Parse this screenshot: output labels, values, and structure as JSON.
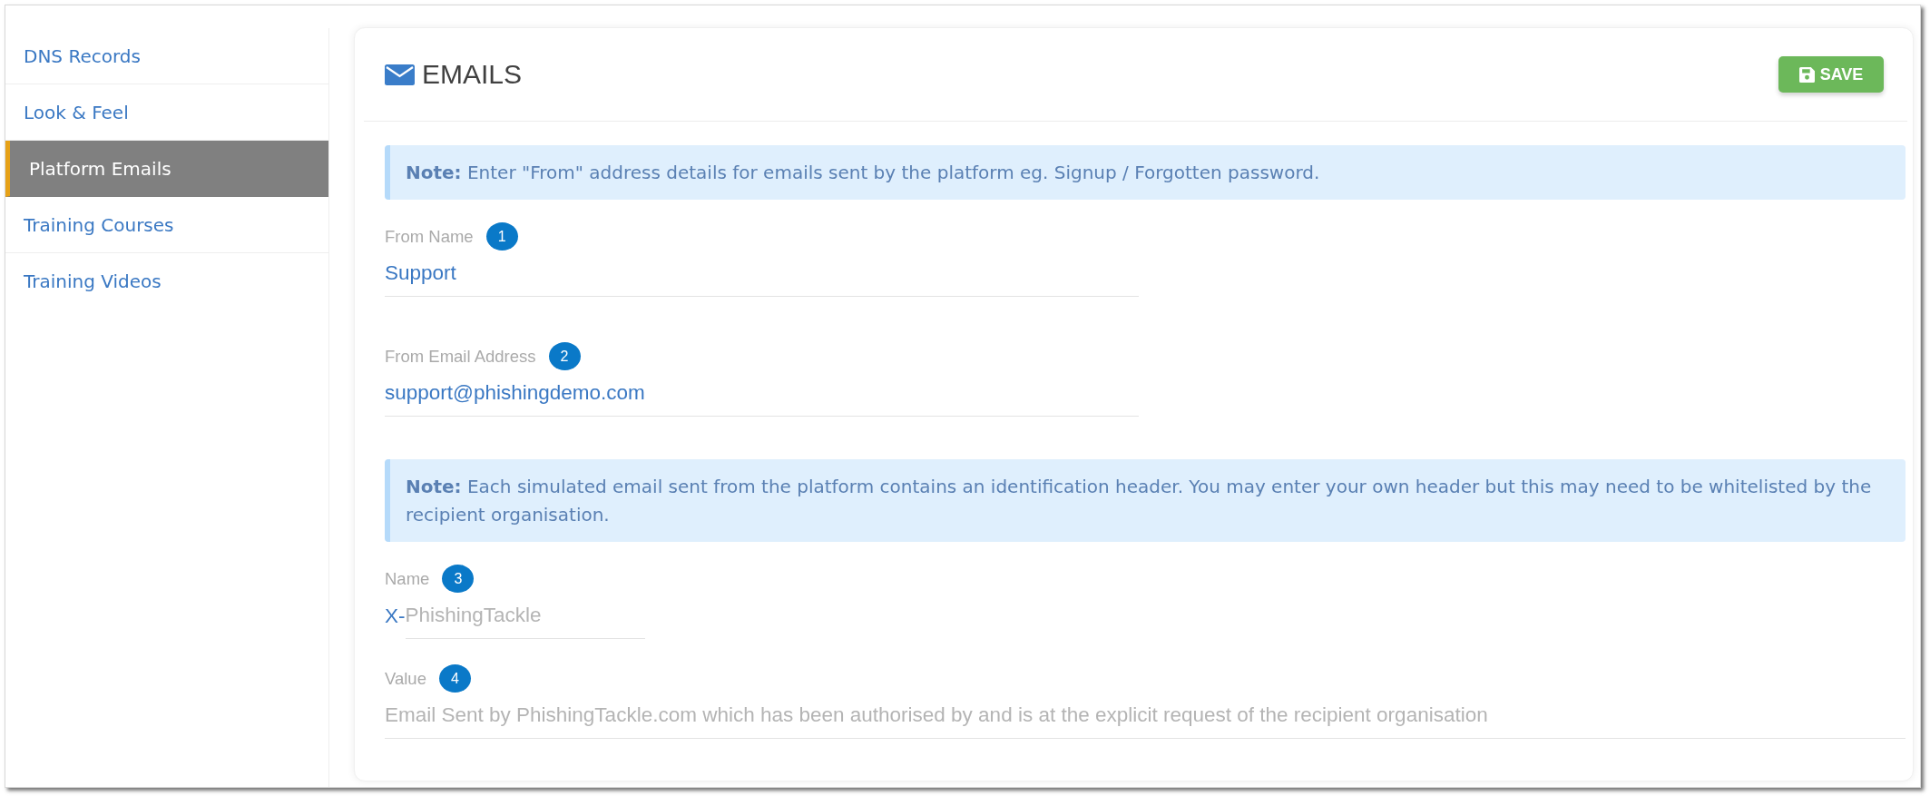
{
  "sidebar": {
    "items": [
      {
        "label": "DNS Records",
        "selected": false
      },
      {
        "label": "Look & Feel",
        "selected": false
      },
      {
        "label": "Platform Emails",
        "selected": true
      },
      {
        "label": "Training Courses",
        "selected": false
      },
      {
        "label": "Training Videos",
        "selected": false
      }
    ]
  },
  "panel": {
    "title": "EMAILS",
    "save_button": "SAVE",
    "content": [
      {
        "kind": "note",
        "text": "**Note:** Enter \"From\" address details for emails sent by the platform eg. Signup / Forgotten password."
      },
      {
        "kind": "field",
        "label": "From Name",
        "badge": "1",
        "value": "Support"
      },
      {
        "kind": "field",
        "label": "From Email Address",
        "badge": "2",
        "value": "support@phishingdemo.com"
      },
      {
        "kind": "note",
        "text": "**Note:** Each simulated email sent from the platform contains an identification header. You may enter your own header but this may need to be whitelisted by the recipient organisation."
      },
      {
        "kind": "field",
        "label": "Name",
        "badge": "3",
        "prefix": "X-",
        "placeholder": "PhishingTackle"
      },
      {
        "kind": "field",
        "label": "Value",
        "badge": "4",
        "placeholder": "Email Sent by PhishingTackle.com which has been authorised by and is at the explicit request of the recipient organisation"
      }
    ]
  }
}
